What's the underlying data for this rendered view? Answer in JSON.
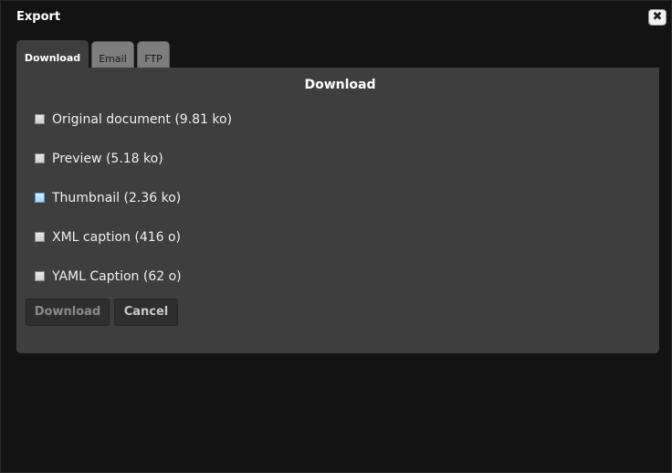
{
  "dialog": {
    "title": "Export",
    "close_icon": "close-icon"
  },
  "tabs": [
    {
      "label": "Download",
      "active": true
    },
    {
      "label": "Email",
      "active": false
    },
    {
      "label": "FTP",
      "active": false
    }
  ],
  "panel": {
    "title": "Download",
    "options": [
      {
        "label": "Original document (9.81 ko)",
        "checked": false
      },
      {
        "label": "Preview (5.18 ko)",
        "checked": false
      },
      {
        "label": "Thumbnail (2.36 ko)",
        "checked": false,
        "hovered": true
      },
      {
        "label": "XML caption (416 o)",
        "checked": false
      },
      {
        "label": "YAML Caption (62 o)",
        "checked": false
      }
    ],
    "download_button": "Download",
    "cancel_button": "Cancel"
  },
  "colors": {
    "dialog_bg": "#131313",
    "panel_bg": "#3e3e3e",
    "inactive_tab_bg": "#7d7d7d",
    "hover_checkbox": "#a9d1f2"
  }
}
